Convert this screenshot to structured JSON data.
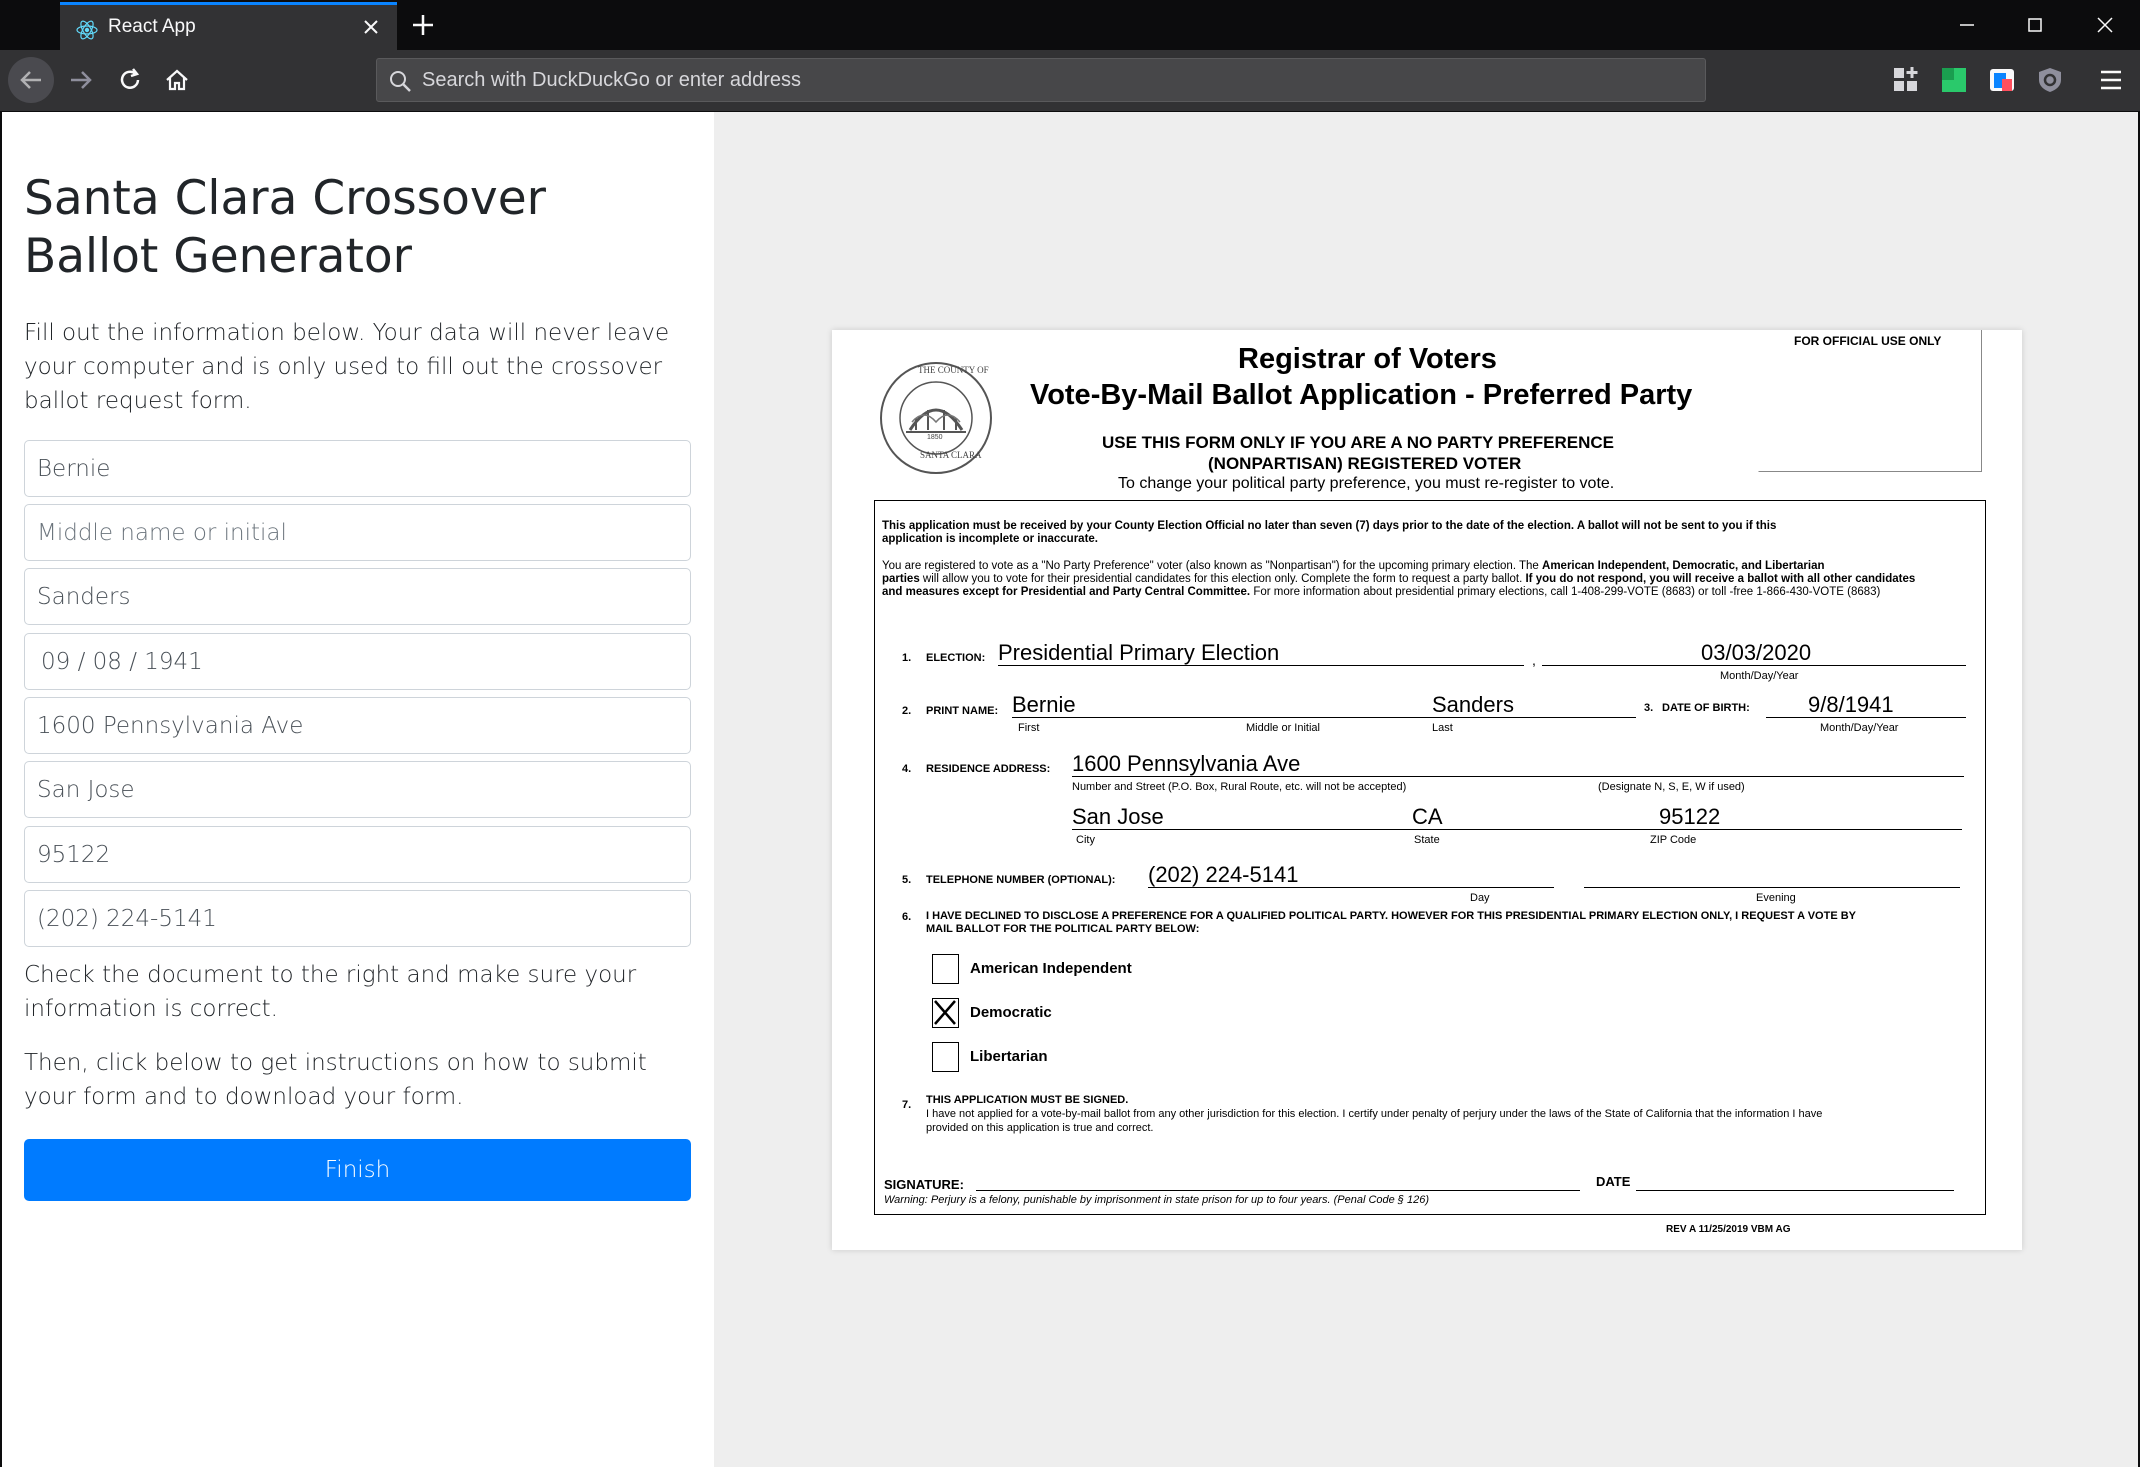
{
  "browser": {
    "tab_title": "React App",
    "url_placeholder": "Search with DuckDuckGo or enter address"
  },
  "app": {
    "title": "Santa Clara Crossover Ballot Generator",
    "intro": "Fill out the information below. Your data will never leave your computer and is only used to fill out the crossover ballot request form.",
    "fields": {
      "first_name": "Bernie",
      "middle_placeholder": "Middle name or initial",
      "last_name": "Sanders",
      "dob": "09 / 08 / 1941",
      "street": "1600 Pennsylvania Ave",
      "city": "San Jose",
      "zip": "95122",
      "phone": "(202) 224-5141"
    },
    "check_text": "Check the document to the right and make sure your information is correct.",
    "then_text": "Then, click below to get instructions on how to submit your form and to download your form.",
    "finish_label": "Finish",
    "colors": {
      "primary": "#007bff",
      "tab_accent": "#0a84ff"
    }
  },
  "ballot": {
    "official_use": "FOR OFFICIAL USE ONLY",
    "title1": "Registrar of Voters",
    "title2": "Vote-By-Mail Ballot Application - Preferred Party",
    "use_form_line1": "USE THIS FORM ONLY IF YOU ARE A NO PARTY PREFERENCE",
    "use_form_line2": "(NONPARTISAN) REGISTERED VOTER",
    "change_pref": "To change your political party preference, you must re-register to vote.",
    "seal": {
      "top": "THE COUNTY OF",
      "bottom": "SANTA CLARA",
      "year": "1850"
    },
    "notice_line1": "This application must be received by your County Election Official no later than seven (7) days prior to the date of the election.  A ballot will not be sent to you if this",
    "notice_line2": "application is incomplete or inaccurate.",
    "para_line1_a": "You are registered to vote as a \"No Party Preference\" voter (also known as \"Nonpartisan\") for the upcoming primary election.  The ",
    "para_line1_b": "American Independent, Democratic, and Libertarian",
    "para_line2_a": "parties",
    "para_line2_b": " will allow you to vote for their presidential candidates for this election only.  Complete the form to request a party ballot.  ",
    "para_line2_c": "If you do not respond, you will  receive a ballot with all other candidates",
    "para_line3_a": "and measures except for Presidential and Party Central Committee.",
    "para_line3_b": "  For more information about presidential primary elections, call 1-408-299-VOTE (8683) or toll -free 1-866-430-VOTE (8683)",
    "n1": "1.",
    "election_label": "ELECTION:",
    "election_value": "Presidential Primary Election",
    "comma": ",",
    "election_date": "03/03/2020",
    "month_day_year": "Month/Day/Year",
    "n2": "2.",
    "print_name_label": "PRINT NAME:",
    "first": "Bernie",
    "last": "Sanders",
    "first_label": "First",
    "middle_label": "Middle or Initial",
    "last_label": "Last",
    "n3": "3.",
    "dob_label": "DATE OF BIRTH:",
    "dob_value": "9/8/1941",
    "dob_sub": "Month/Day/Year",
    "n4": "4.",
    "residence_label": "RESIDENCE ADDRESS:",
    "street_value": "1600 Pennsylvania Ave",
    "street_sub": "Number and Street (P.O. Box, Rural Route, etc. will not be accepted)",
    "designate_sub": "(Designate N, S, E, W if used)",
    "city_value": "San Jose",
    "state_value": "CA",
    "zip_value": "95122",
    "city_sub": "City",
    "state_sub": "State",
    "zip_sub": "ZIP Code",
    "n5": "5.",
    "phone_label": "TELEPHONE NUMBER (OPTIONAL):",
    "phone_value": "(202) 224-5141",
    "day_sub": "Day",
    "evening_sub": "Evening",
    "n6": "6.",
    "decline_line1": "I HAVE DECLINED TO DISCLOSE A PREFERENCE FOR A QUALIFIED POLITICAL PARTY.  HOWEVER FOR THIS PRESIDENTIAL PRIMARY ELECTION ONLY, I REQUEST A VOTE BY",
    "decline_line2": "MAIL BALLOT FOR THE POLITICAL PARTY BELOW:",
    "parties": [
      {
        "label": "American Independent",
        "checked": false
      },
      {
        "label": "Democratic",
        "checked": true
      },
      {
        "label": "Libertarian",
        "checked": false
      }
    ],
    "n7": "7.",
    "must_sign": "THIS APPLICATION MUST BE SIGNED.",
    "certify_line1": "I have not applied for a vote-by-mail ballot from any other jurisdiction for this election. I certify under penalty of perjury under the laws of the State of California that the information I have",
    "certify_line2": "provided on this application is true and correct.",
    "signature_label": "SIGNATURE:",
    "date_label": "DATE",
    "warning": "Warning: Perjury is a felony, punishable by imprisonment in state prison for up to four years. (Penal Code § 126)",
    "rev": "REV A 11/25/2019 VBM AG"
  }
}
